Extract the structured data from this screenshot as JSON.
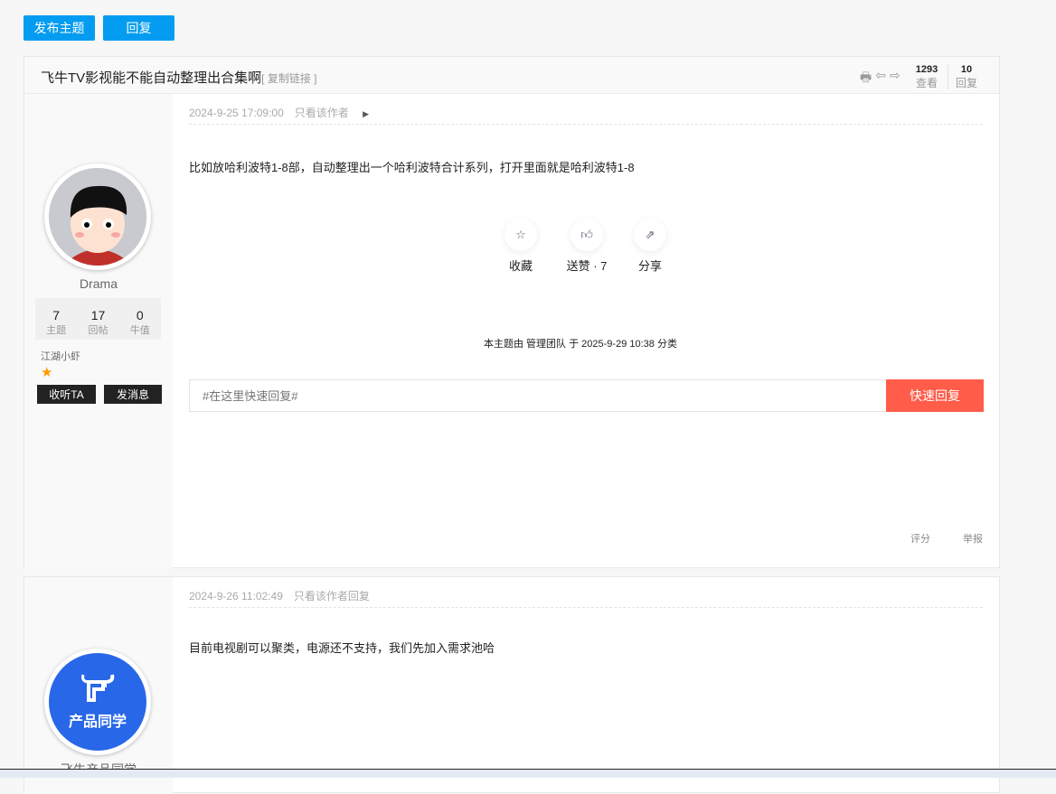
{
  "toolbar": {
    "new_topic": "发布主题",
    "reply": "回复"
  },
  "thread": {
    "title": "飞牛TV影视能不能自动整理出合集啊",
    "copy_link": "[ 复制链接 ]",
    "views": "1293",
    "views_label": "查看",
    "replies": "10",
    "replies_label": "回复"
  },
  "post1": {
    "time": "2024-9-25 17:09:00",
    "only_author": "只看该作者",
    "content": "比如放哈利波特1-8部，自动整理出一个哈利波特合计系列，打开里面就是哈利波特1-8",
    "user": {
      "name": "Drama",
      "topics": "7",
      "topics_label": "主题",
      "posts": "17",
      "posts_label": "回帖",
      "niu": "0",
      "niu_label": "牛值",
      "rank": "江湖小虾",
      "follow": "收听TA",
      "message": "发消息"
    },
    "actions": {
      "fav": "收藏",
      "like": "送赞",
      "like_count": "· 7",
      "share": "分享"
    },
    "mod_note": "本主题由 管理团队 于 2025-9-29 10:38 分类",
    "quick_reply_placeholder": "#在这里快速回复#",
    "quick_reply_btn": "快速回复",
    "rate": "评分",
    "report": "举报"
  },
  "post2": {
    "time": "2024-9-26 11:02:49",
    "only_author": "只看该作者回复",
    "content": "目前电视剧可以聚类，电源还不支持，我们先加入需求池哈",
    "user": {
      "name": "飞牛产品同学",
      "avatar_text": "产品同学"
    }
  }
}
